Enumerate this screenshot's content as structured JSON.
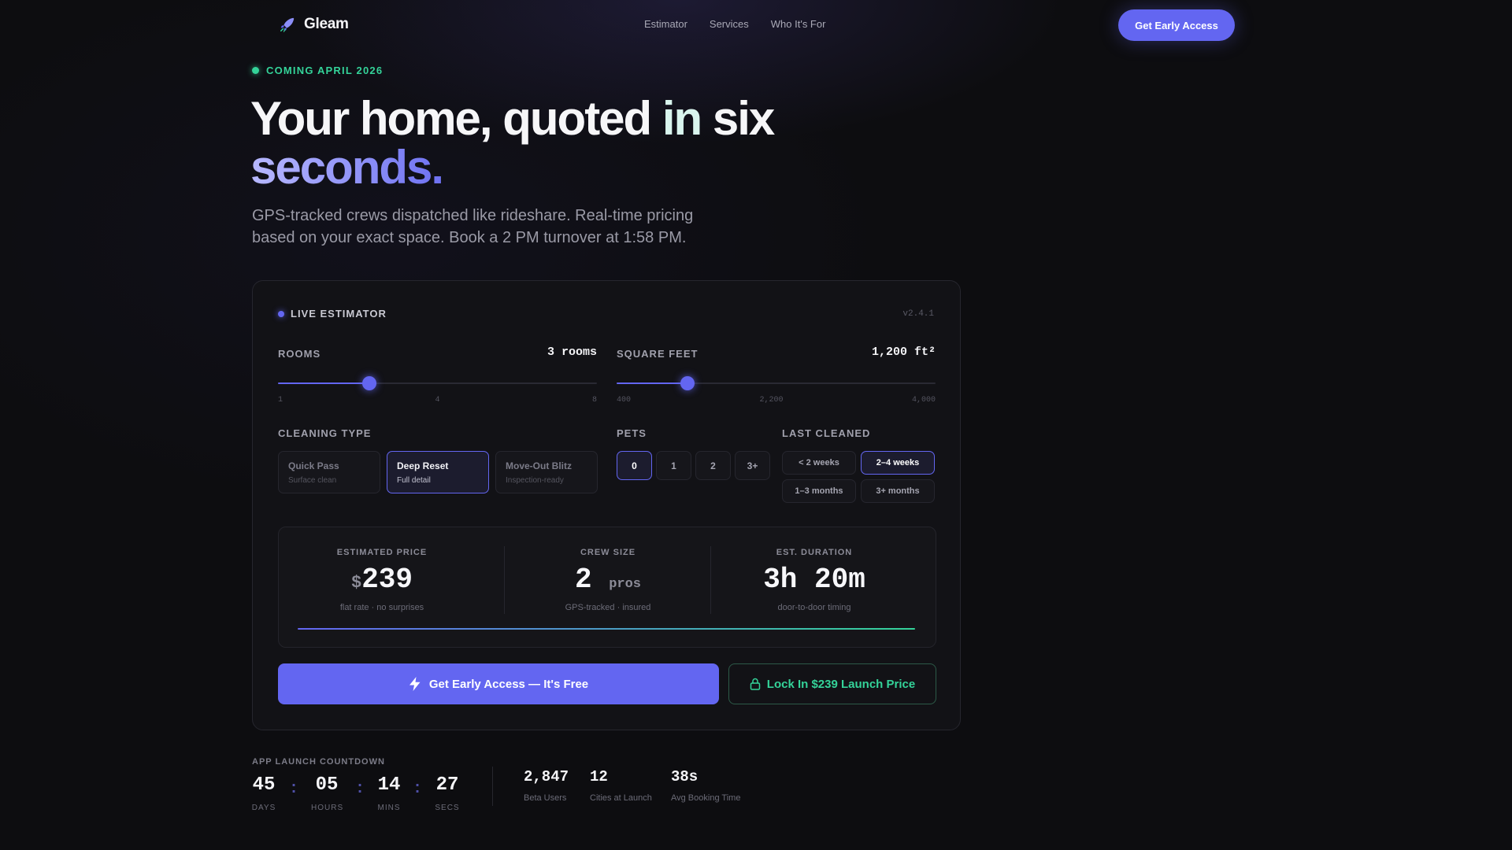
{
  "brand": {
    "name": "Gleam",
    "accent": "#6366f1",
    "success": "#34d399"
  },
  "nav": {
    "links": [
      "Estimator",
      "Services",
      "Who It's For"
    ],
    "cta": "Get Early Access"
  },
  "hero": {
    "badge": "COMING APRIL 2026",
    "title_line1_a": "Your home, quoted ",
    "title_line1_b": "in",
    "title_line1_c": " six",
    "title_line2": "seconds.",
    "subtitle": "GPS-tracked crews dispatched like rideshare. Real-time pricing based on your exact space. Book a 2 PM turnover at 1:58 PM."
  },
  "estimator": {
    "label": "LIVE ESTIMATOR",
    "version": "v2.4.1",
    "rooms": {
      "label": "ROOMS",
      "value_text": "3 rooms",
      "value": 3,
      "min": 1,
      "max": 8,
      "ticks": [
        "1",
        "4",
        "8"
      ]
    },
    "sqft": {
      "label": "SQUARE FEET",
      "value_text": "1,200 ft²",
      "value": 1200,
      "min": 400,
      "max": 4000,
      "ticks": [
        "400",
        "2,200",
        "4,000"
      ]
    },
    "cleaning_type": {
      "label": "CLEANING TYPE",
      "options": [
        {
          "title": "Quick Pass",
          "sub": "Surface clean"
        },
        {
          "title": "Deep Reset",
          "sub": "Full detail"
        },
        {
          "title": "Move-Out Blitz",
          "sub": "Inspection-ready"
        }
      ],
      "selected": "Deep Reset"
    },
    "pets": {
      "label": "PETS",
      "options": [
        "0",
        "1",
        "2",
        "3+"
      ],
      "selected": "0"
    },
    "last_cleaned": {
      "label": "LAST CLEANED",
      "options": [
        "< 2 weeks",
        "2–4 weeks",
        "1–3 months",
        "3+ months"
      ],
      "selected": "2–4 weeks"
    },
    "results": {
      "price": {
        "label": "ESTIMATED PRICE",
        "currency": "$",
        "value": "239",
        "note": "flat rate · no surprises"
      },
      "crew": {
        "label": "CREW SIZE",
        "value": "2",
        "unit": "pros",
        "note": "GPS-tracked · insured"
      },
      "duration": {
        "label": "EST. DURATION",
        "value": "3h 20m",
        "note": "door-to-door timing"
      }
    },
    "cta_primary": "Get Early Access — It's Free",
    "cta_secondary": "Lock In $239 Launch Price"
  },
  "countdown": {
    "label": "APP LAUNCH COUNTDOWN",
    "units": [
      {
        "value": "45",
        "caption": "DAYS"
      },
      {
        "value": "05",
        "caption": "HOURS"
      },
      {
        "value": "14",
        "caption": "MINS"
      },
      {
        "value": "27",
        "caption": "SECS"
      }
    ],
    "separator": ":"
  },
  "stats": [
    {
      "value": "2,847",
      "caption": "Beta Users"
    },
    {
      "value": "12",
      "caption": "Cities at Launch"
    },
    {
      "value": "38s",
      "caption": "Avg Booking Time"
    }
  ]
}
